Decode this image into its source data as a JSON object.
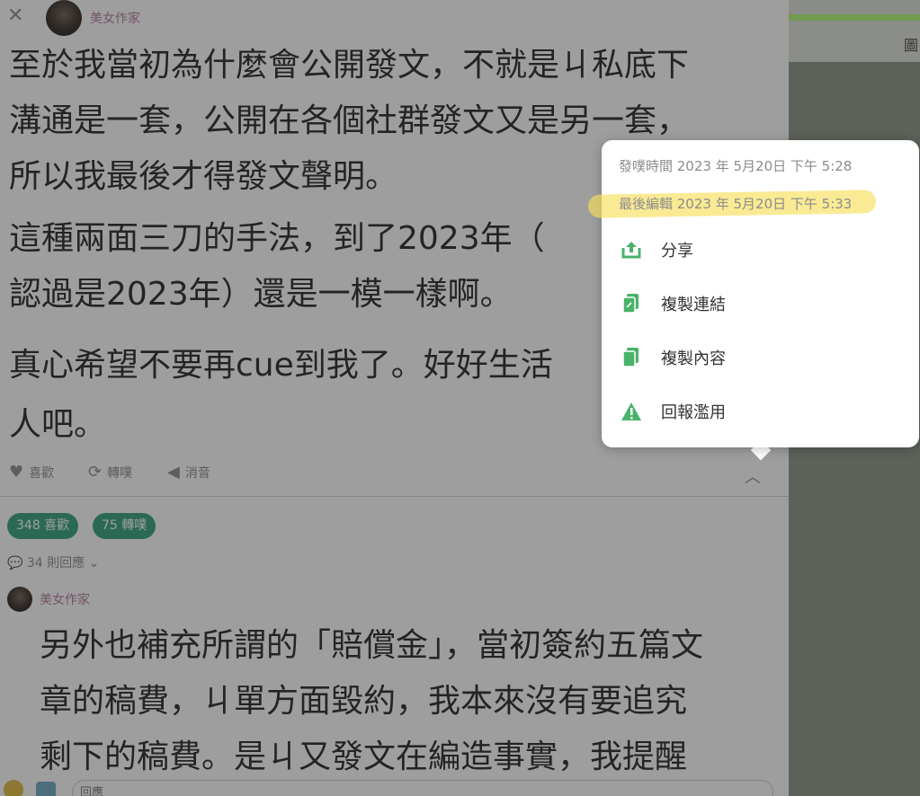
{
  "header": {
    "author": "美女作家"
  },
  "post": {
    "paragraphs": [
      [
        "至於我當初為什麼會公開發文，不就是ㄐ私底下",
        "溝通是一套，公開在各個社群發文又是另一套，",
        "所以我最後才得發文聲明。"
      ],
      [
        "這種兩面三刀的手法，到了2023年（",
        "認過是2023年）還是一模一樣啊。"
      ],
      [
        "真心希望不要再cue到我了。好好生活",
        "人吧。"
      ]
    ]
  },
  "actions": {
    "like": "喜歡",
    "replurk": "轉噗",
    "mute": "消音"
  },
  "stats": {
    "likes": "348 喜歡",
    "replurks": "75 轉噗",
    "replies": "34 則回應"
  },
  "reply": {
    "author": "美女作家",
    "lines": [
      "另外也補充所謂的「賠償金」，當初簽約五篇文",
      "章的稿費，ㄐ單方面毀約，我本來沒有要追究",
      "剩下的稿費。是ㄐ又發文在編造事實，我提醒"
    ]
  },
  "compose": {
    "placeholder": "回應"
  },
  "side": {
    "glyph": "圖"
  },
  "popup": {
    "posted": "發噗時間 2023 年 5月20日 下午 5:28",
    "edited": "最後編輯 2023 年 5月20日 下午 5:33",
    "items": [
      {
        "label": "分享",
        "icon": "share-icon"
      },
      {
        "label": "複製連結",
        "icon": "copy-link-icon"
      },
      {
        "label": "複製內容",
        "icon": "copy-content-icon"
      },
      {
        "label": "回報濫用",
        "icon": "warning-icon"
      }
    ]
  },
  "colors": {
    "accent_green": "#2f9e7a",
    "author_pink": "#b07a9c",
    "icon_green": "#49b36b",
    "highlight_yellow": "#f8de5a"
  }
}
